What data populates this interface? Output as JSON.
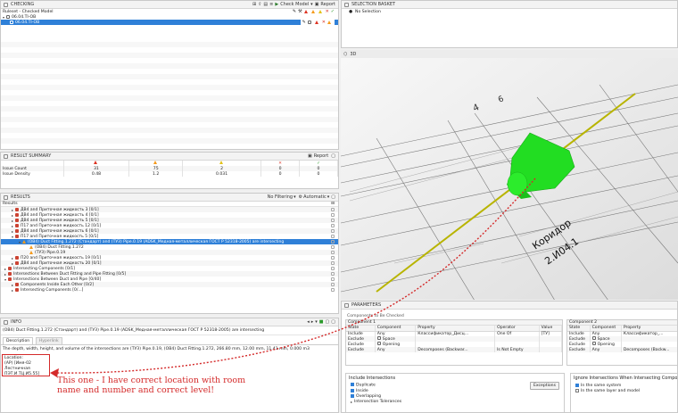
{
  "checking": {
    "title": "CHECKING",
    "toolbar_check_model": "Check Model",
    "toolbar_report": "Report",
    "ruleset_label": "Ruleset - Checked Model",
    "tree_root": "06.04.TI-OB",
    "tree_child": "06.04.TI-OB"
  },
  "selection_basket": {
    "title": "SELECTION BASKET",
    "no_selection": "No Selection"
  },
  "view3d": {
    "title": "3D",
    "room_name": "Коридор",
    "room_number": "2.И04.1",
    "grid_label_1": "4",
    "grid_label_2": "6",
    "colors": {
      "clash": "#22dd22",
      "pipe": "#b8b400",
      "bg": "#ececec"
    }
  },
  "result_summary": {
    "title": "RESULT SUMMARY",
    "report": "Report",
    "rows": [
      {
        "label": "Issue Count",
        "values": [
          "31",
          "75",
          "2",
          "0",
          "0"
        ]
      },
      {
        "label": "Issue Density",
        "values": [
          "0.48",
          "1.2",
          "0.031",
          "0",
          "0"
        ]
      }
    ]
  },
  "results": {
    "title": "RESULTS",
    "filter": "No Filtering",
    "mode": "Automatic",
    "header": "Results",
    "rows": [
      {
        "indent": 1,
        "expand": "▸",
        "text": "ДВ4 and Приточная жидкость 3 [0/1]",
        "status": "red"
      },
      {
        "indent": 1,
        "expand": "▸",
        "text": "ДВ4 and Приточная жидкость 4 [0/1]",
        "status": "red"
      },
      {
        "indent": 1,
        "expand": "▸",
        "text": "ДВ4 and Приточная жидкость 5 [0/1]",
        "status": "red"
      },
      {
        "indent": 1,
        "expand": "▸",
        "text": "П17 and Приточная жидкость 12 [0/1]",
        "status": "red"
      },
      {
        "indent": 1,
        "expand": "▸",
        "text": "ДВ4 and Приточная жидкость 6 [0/1]",
        "status": "red"
      },
      {
        "indent": 1,
        "expand": "▾",
        "text": "П17 and Приточная жидкость 5 [0/1]",
        "status": "red"
      },
      {
        "indent": 2,
        "expand": "▾",
        "text": "(ОВ4) Duct Fitting.1.272 (Стандарт) and (ТУЗ) Pipe.0.19 (ADSK_Медная-металлическая ГОСТ Р 52318-2005) are intersecting",
        "status": "tri",
        "selected": true
      },
      {
        "indent": 3,
        "expand": "",
        "text": "(ОВ4) Duct Fitting.1.272",
        "status": "tri"
      },
      {
        "indent": 3,
        "expand": "",
        "text": "(ТУЗ) Pipe.0.19",
        "status": "tri"
      },
      {
        "indent": 1,
        "expand": "▸",
        "text": "П20 and Приточная жидкость 19 [0/1]",
        "status": "red"
      },
      {
        "indent": 1,
        "expand": "▸",
        "text": "ДВ4 and Приточная жидкость 20 [0/1]",
        "status": "red"
      },
      {
        "indent": 0,
        "expand": "▸",
        "text": "Intersecting Components [0/1]",
        "status": "red"
      },
      {
        "indent": 0,
        "expand": "▸",
        "text": "Intersections Between Duct Fitting and Pipe Fitting [0/5]",
        "status": "red"
      },
      {
        "indent": 0,
        "expand": "▾",
        "text": "Intersections Between Duct and Pipe [0/40]",
        "status": "red"
      },
      {
        "indent": 1,
        "expand": "▸",
        "text": "Components Inside Each Other [0/2]",
        "status": "red"
      },
      {
        "indent": 1,
        "expand": "▸",
        "text": "Intersecting Components [0/...]",
        "status": "red"
      }
    ]
  },
  "info": {
    "title": "INFO",
    "heading": "(ОВ4) Duct Fitting.1.272 (Стандарт) and (ТУЗ) Pipe.0.19 (ADSK_Медная-металлическая ГОСТ Р 52318-2005) are intersecting",
    "tabs": [
      "Description",
      "Hyperlink"
    ],
    "description": "The depth, width, height, and volume of the intersections are (ТУЗ) Pipe.0.19, (ОВ4) Duct Fitting.1.272, 266.80 mm, 12.00 mm, 11.41 mm, 0.000 m3",
    "location_lines": [
      "Location:",
      "(AP) [Имя-02",
      "Лестничная ПЭТ.И.ТЦ.И5.55]"
    ]
  },
  "annotation": {
    "text": "This one - I have correct location with room name and number and correct level!"
  },
  "parameters": {
    "title": "PARAMETERS",
    "group_checked": "Components to Be Checked",
    "comp1": "Component 1",
    "comp2": "Component 2",
    "headers1": [
      "State",
      "Component",
      "Property",
      "Operator",
      "Value"
    ],
    "rows1": [
      [
        "Include",
        "Any",
        "Классификатор_Дисц...",
        "One Of",
        "[ТУ]"
      ],
      [
        "Exclude",
        "Space",
        "",
        "",
        ""
      ],
      [
        "Exclude",
        "Opening",
        "",
        "",
        ""
      ],
      [
        "Exclude",
        "Any",
        "Decomposes (Backwar...",
        "Is Not Empty",
        ""
      ]
    ],
    "headers2": [
      "State",
      "Component",
      "Property"
    ],
    "rows2": [
      [
        "Include",
        "Any",
        "Классификатор_..."
      ],
      [
        "Exclude",
        "Space",
        ""
      ],
      [
        "Exclude",
        "Opening",
        ""
      ],
      [
        "Exclude",
        "Any",
        "Decomposes (Backw..."
      ]
    ],
    "include_intersections": "Include Intersections",
    "opt_duplicate": "Duplicate",
    "opt_inside": "Inside",
    "opt_overlapping": "Overlapping",
    "exceptions": "Exceptions",
    "ignore_title": "Ignore Intersections When Intersecting Components Are",
    "ignore_opt1": "In the same system",
    "ignore_opt2": "In the same layer and model",
    "tolerance_label": "Intersection Tolerances"
  }
}
